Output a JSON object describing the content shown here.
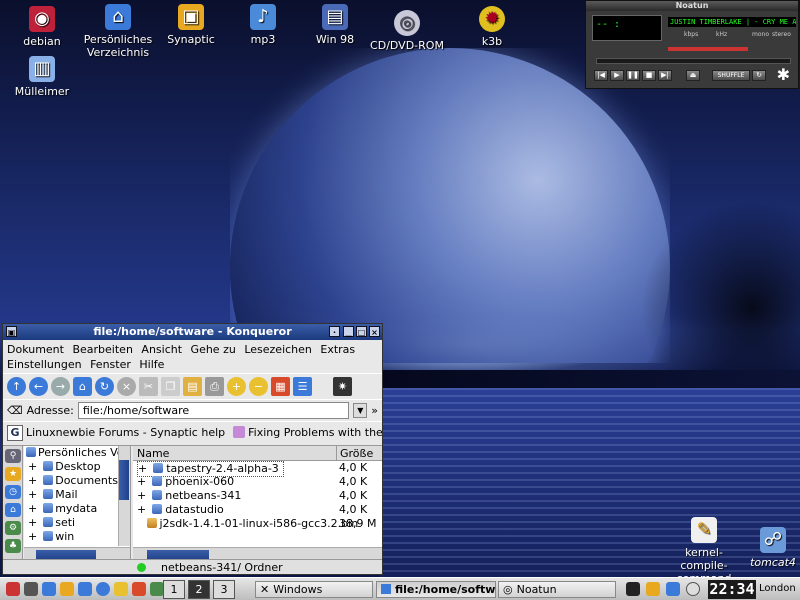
{
  "desktop_icons": [
    {
      "label": "debian",
      "icon": "debian-icon",
      "color": "#c0213a"
    },
    {
      "label": "Persönliches Verzeichnis",
      "icon": "home-folder-icon",
      "color": "#3b7ad8"
    },
    {
      "label": "Synaptic",
      "icon": "synaptic-package-icon",
      "color": "#e8a820"
    },
    {
      "label": "mp3",
      "icon": "mp3-folder-icon",
      "color": "#4a8ad8"
    },
    {
      "label": "Win 98",
      "icon": "windows-drive-icon",
      "color": "#4a6ab8"
    },
    {
      "label": "CD/DVD-ROM",
      "icon": "cdrom-icon",
      "color": "#c8c8d8"
    },
    {
      "label": "k3b",
      "icon": "k3b-burn-icon",
      "color": "#e0c020"
    },
    {
      "label": "Mülleimer",
      "icon": "trash-icon",
      "color": "#8ab0e8"
    },
    {
      "label": "kernel-compile-command",
      "icon": "text-file-icon",
      "color": "#f0f0f0"
    },
    {
      "label": "tomcat4",
      "icon": "tomcat-link-icon",
      "color": "#6a9ad8"
    }
  ],
  "noatun": {
    "title": "Noatun",
    "display_text": "-- :",
    "marquee": "JUSTIN TIMBERLAKE | - CRY ME A R",
    "kbps_label": "kbps",
    "khz_label": "kHz",
    "mono_label": "mono",
    "stereo_label": "stereo",
    "shuffle_label": "SHUFFLE"
  },
  "konqueror": {
    "title": "file:/home/software - Konqueror",
    "menu_row1": [
      "Dokument",
      "Bearbeiten",
      "Ansicht",
      "Gehe zu",
      "Lesezeichen",
      "Extras"
    ],
    "menu_row2": [
      "Einstellungen",
      "Fenster",
      "Hilfe"
    ],
    "address_label": "Adresse:",
    "address_value": "file:/home/software",
    "bookmarks": [
      "Linuxnewbie Forums - Synaptic help",
      "Fixing Problems with the Im"
    ],
    "tree": [
      "Persönliches Ve",
      "Desktop",
      "Documents",
      "Mail",
      "mydata",
      "seti",
      "win"
    ],
    "columns": {
      "name": "Name",
      "size": "Größe"
    },
    "files": [
      {
        "name": "tapestry-2.4-alpha-3",
        "size": "4,0 K"
      },
      {
        "name": "phoenix-060",
        "size": "4,0 K"
      },
      {
        "name": "netbeans-341",
        "size": "4,0 K"
      },
      {
        "name": "datastudio",
        "size": "4,0 K"
      },
      {
        "name": "j2sdk-1.4.1-01-linux-i586-gcc3.2.bin",
        "size": "38,9 M"
      }
    ],
    "status": "netbeans-341/  Ordner"
  },
  "taskbar": {
    "pager": [
      "1",
      "2",
      "3"
    ],
    "tasks": [
      "Windows",
      "file:/home/software",
      "Noatun"
    ],
    "clock": "22:34",
    "clock_city": "London"
  }
}
